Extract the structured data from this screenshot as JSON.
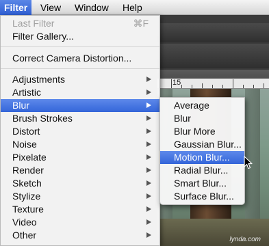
{
  "menubar": {
    "items": [
      "Filter",
      "View",
      "Window",
      "Help"
    ]
  },
  "filter_menu": {
    "last_filter": "Last Filter",
    "last_filter_shortcut": "⌘F",
    "filter_gallery": "Filter Gallery...",
    "correct_camera": "Correct Camera Distortion...",
    "submenus": [
      "Adjustments",
      "Artistic",
      "Blur",
      "Brush Strokes",
      "Distort",
      "Noise",
      "Pixelate",
      "Render",
      "Sketch",
      "Stylize",
      "Texture",
      "Video",
      "Other"
    ],
    "selected": "Blur"
  },
  "blur_submenu": {
    "items": [
      "Average",
      "Blur",
      "Blur More",
      "Gaussian Blur...",
      "Motion Blur...",
      "Radial Blur...",
      "Smart Blur...",
      "Surface Blur..."
    ],
    "selected": "Motion Blur..."
  },
  "ruler": {
    "label": "15"
  },
  "credit": "lynda.com",
  "colors": {
    "highlight": "#3465d9",
    "menu_bg": "#f8f8f8"
  },
  "icons": {
    "submenu_arrow": "chevron-right-icon",
    "cursor": "mouse-pointer-icon"
  }
}
